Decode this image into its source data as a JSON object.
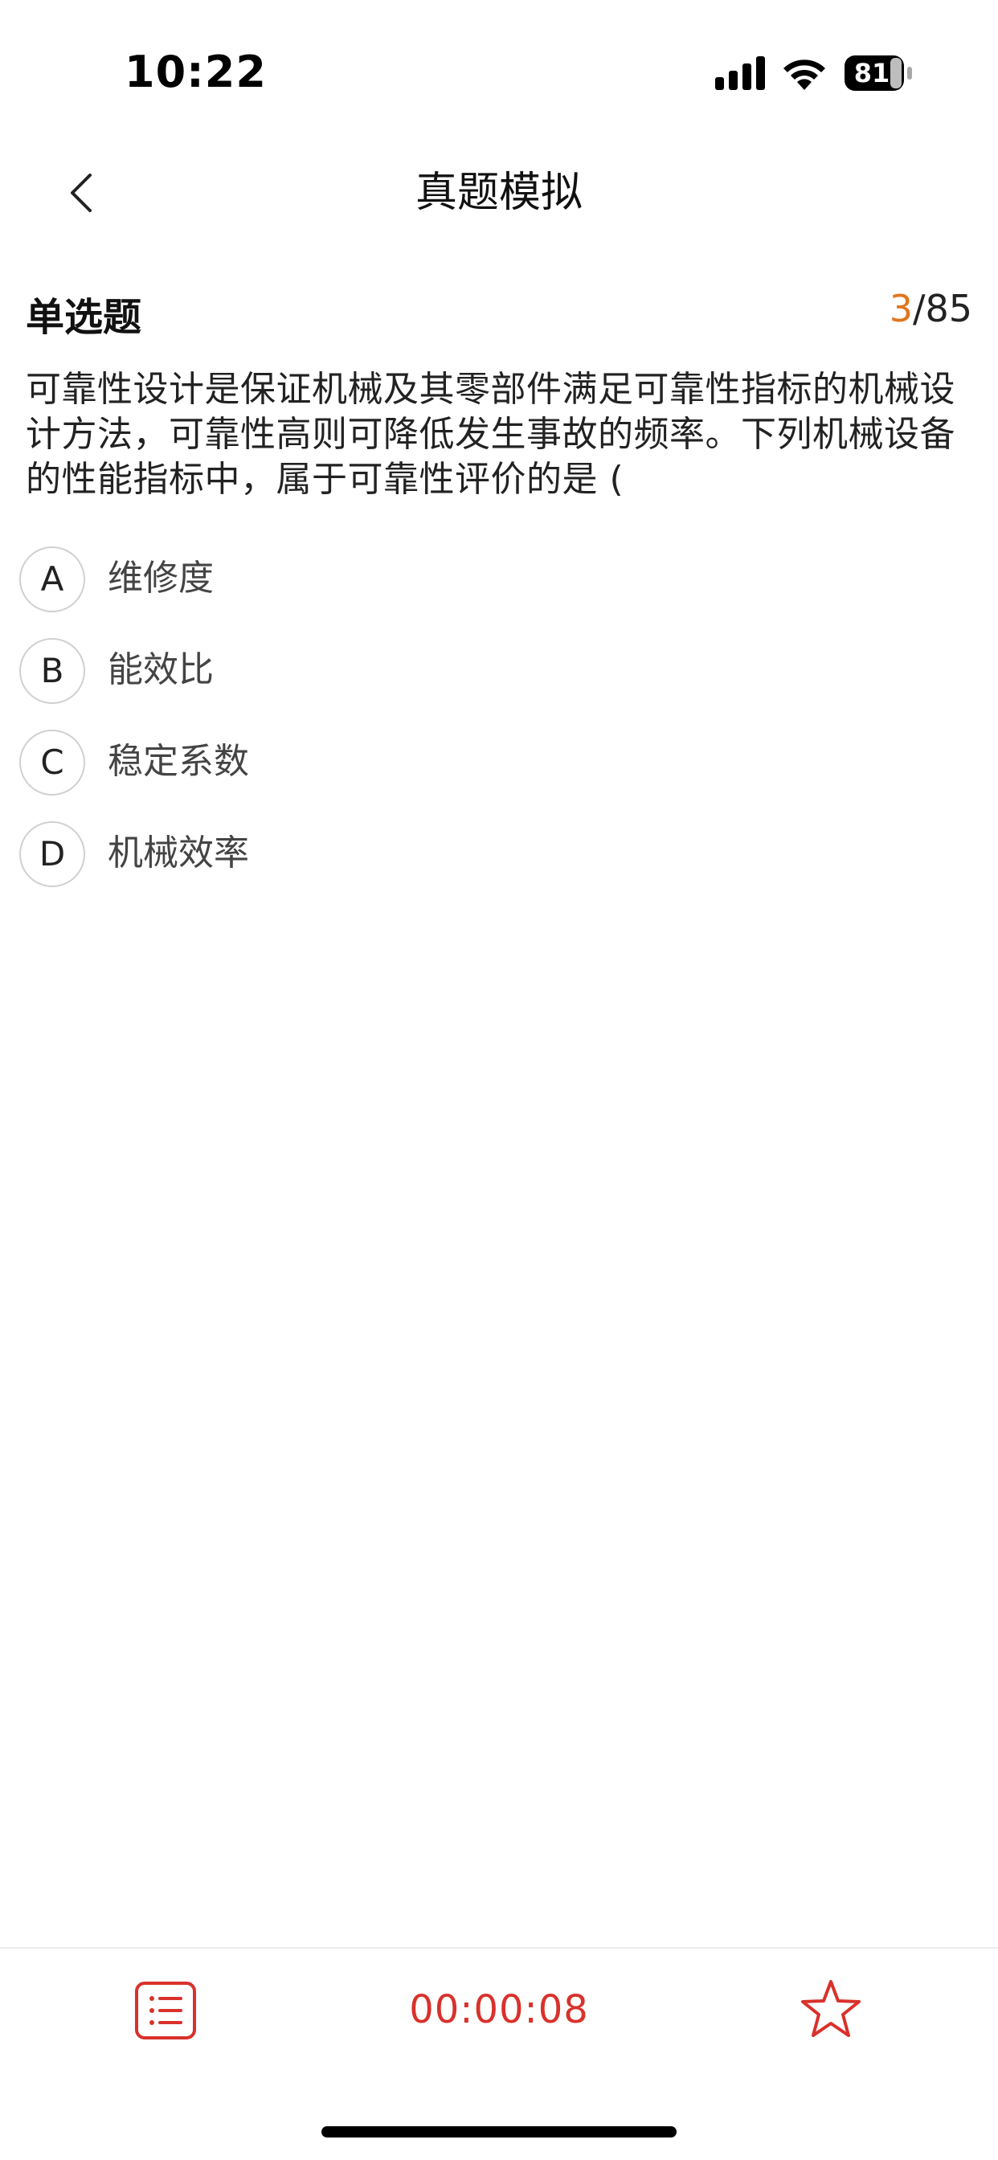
{
  "status_bar": {
    "time": "10:22",
    "battery_level": "81",
    "icons": [
      "signal-icon",
      "wifi-icon",
      "battery-icon"
    ]
  },
  "nav": {
    "title": "真题模拟",
    "back_icon": "chevron-left-icon"
  },
  "question": {
    "type_label": "单选题",
    "current": "3",
    "separator_total": "/85",
    "stem": "可靠性设计是保证机械及其零部件满足可靠性指标的机械设计方法，可靠性高则可降低发生事故的频率。下列机械设备的性能指标中，属于可靠性评价的是 (",
    "options": [
      {
        "letter": "A",
        "text": "维修度"
      },
      {
        "letter": "B",
        "text": "能效比"
      },
      {
        "letter": "C",
        "text": "稳定系数"
      },
      {
        "letter": "D",
        "text": "机械效率"
      }
    ]
  },
  "bottom_bar": {
    "timer": "00:00:08",
    "sheet_icon": "answer-sheet-icon",
    "favorite_icon": "star-icon"
  },
  "colors": {
    "accent_orange": "#e0761f",
    "accent_red": "#d9312b"
  }
}
